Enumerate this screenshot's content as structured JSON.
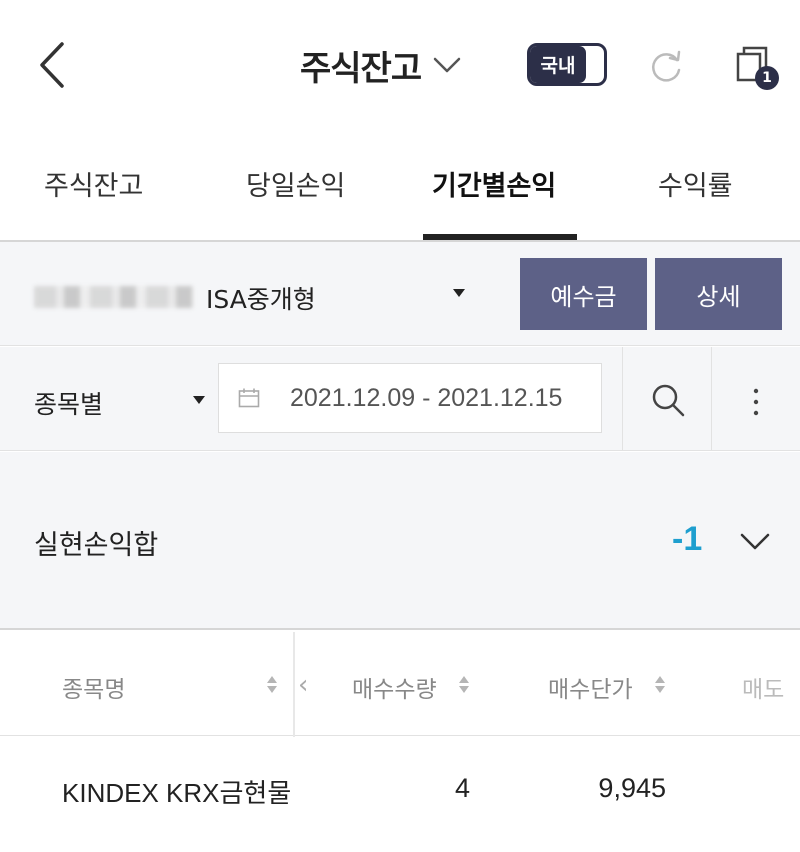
{
  "header": {
    "title": "주식잔고",
    "toggle_label": "국내",
    "window_badge": "1"
  },
  "tabs": [
    {
      "label": "주식잔고",
      "active": false
    },
    {
      "label": "당일손익",
      "active": false
    },
    {
      "label": "기간별손익",
      "active": true
    },
    {
      "label": "수익률",
      "active": false
    }
  ],
  "account": {
    "name": "ISA중개형",
    "deposit_label": "예수금",
    "detail_label": "상세"
  },
  "filter": {
    "type_label": "종목별",
    "date_range": "2021.12.09 - 2021.12.15"
  },
  "summary": {
    "label": "실현손익합",
    "value": "-1"
  },
  "table": {
    "columns": [
      "종목명",
      "매수수량",
      "매수단가",
      "매도"
    ],
    "rows": [
      {
        "name": "KINDEX KRX금현물",
        "qty": "4",
        "price": "9,945"
      }
    ]
  },
  "colors": {
    "accent_button": "#5d6187",
    "dark": "#2c2f48",
    "profit_value": "#1e9fcf"
  }
}
